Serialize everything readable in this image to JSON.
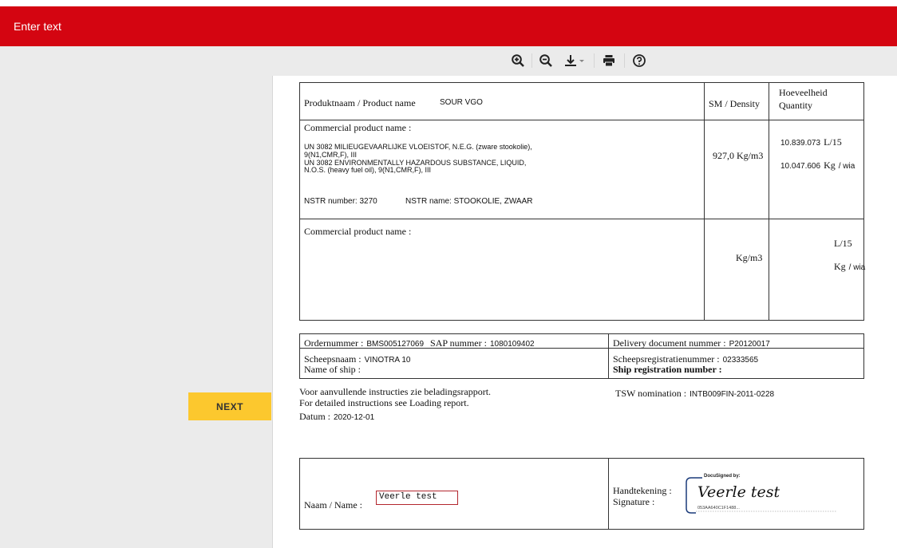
{
  "header": {
    "title": "Enter text"
  },
  "toolbar": {
    "buttons": [
      "zoom-in-icon",
      "zoom-out-icon",
      "download-icon",
      "print-icon",
      "help-icon"
    ]
  },
  "sidebar": {
    "next_label": "NEXT"
  },
  "product_table": {
    "row1": {
      "label": "Produktnaam / Product name",
      "value": "SOUR VGO",
      "density_header": "SM / Density",
      "quantity_header_1": "Hoeveelheid",
      "quantity_header_2": "Quantity"
    },
    "row2": {
      "label": "Commercial product name :",
      "desc_1": "UN 3082 MILIEUGEVAARLIJKE VLOEISTOF, N.E.G. (zware stookolie),",
      "desc_2": "9(N1,CMR,F), III",
      "desc_3": "UN 3082 ENVIRONMENTALLY HAZARDOUS SUBSTANCE, LIQUID,",
      "desc_4": "N.O.S. (heavy fuel oil), 9(N1,CMR,F), III",
      "nstr_number": "NSTR number: 3270",
      "nstr_name": "NSTR name: STOOKOLIE, ZWAAR",
      "density": "927,0 Kg/m3",
      "qty_l_value": "10.839.073",
      "qty_l_unit": "L/15",
      "qty_kg_value": "10.047.606",
      "qty_kg_unit": "Kg",
      "qty_kg_suffix": "/ wia"
    },
    "row3": {
      "label": "Commercial product name :",
      "density": "Kg/m3",
      "qty_l_unit": "L/15",
      "qty_kg_unit": "Kg",
      "qty_kg_suffix": "/ wia"
    }
  },
  "order_table": {
    "ordernummer_label": "Ordernummer :",
    "ordernummer_value": "BMS005127069",
    "sap_label": "SAP nummer :",
    "sap_value": "1080109402",
    "delivery_label": "Delivery document nummer :",
    "delivery_value": "P20120017",
    "ship_label_1": "Scheepsnaam :",
    "ship_value": "VINOTRA 10",
    "ship_label_2": "Name of ship :",
    "reg_label_1": "Scheepsregistratienummer :",
    "reg_value": "02333565",
    "reg_label_2": "Ship registration number :"
  },
  "instructions": {
    "line1": "Voor aanvullende instructies zie beladingsrapport.",
    "line2": "For detailed instructions see Loading report.",
    "datum_label": "Datum :",
    "datum_value": "2020-12-01",
    "tsw_label": "TSW nomination :",
    "tsw_value": "INTB009FIN-2011-0228"
  },
  "signature_table": {
    "name_label": "Naam / Name :",
    "name_value": "Veerle test",
    "sig_label_1": "Handtekening :",
    "sig_label_2": "Signature :",
    "docusigned": "DocuSigned by:",
    "signature_text": "Veerle test",
    "doc_id": "053AA640C1F1488..."
  },
  "colors": {
    "header_red": "#d40511",
    "next_yellow": "#fcc82e",
    "input_border": "#b3262e"
  }
}
